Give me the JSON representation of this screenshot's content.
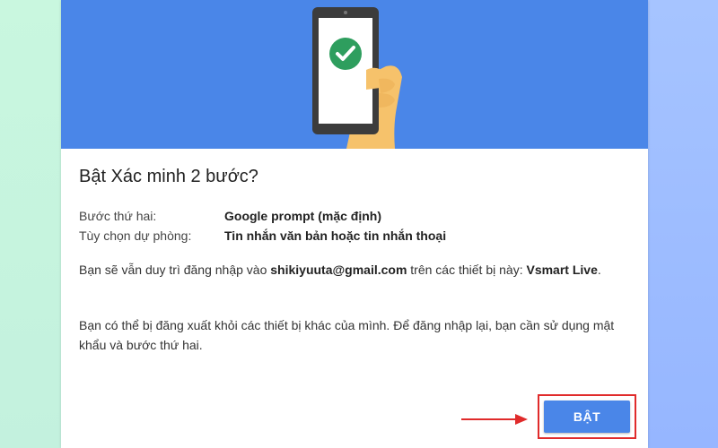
{
  "dialog": {
    "title": "Bật Xác minh 2 bước?",
    "details": [
      {
        "label": "Bước thứ hai:",
        "value": "Google prompt (mặc định)"
      },
      {
        "label": "Tùy chọn dự phòng:",
        "value": "Tin nhắn văn bản hoặc tin nhắn thoại"
      }
    ],
    "para1": {
      "text_a": "Bạn sẽ vẫn duy trì đăng nhập vào ",
      "email": "shikiyuuta@gmail.com",
      "text_b": " trên các thiết bị này: ",
      "device": "Vsmart Live",
      "text_c": "."
    },
    "para2": "Bạn có thể bị đăng xuất khỏi các thiết bị khác của mình. Để đăng nhập lại, bạn cần sử dụng mật khẩu và bước thứ hai.",
    "button_label": "BẬT"
  },
  "colors": {
    "banner": "#4a86e8",
    "check": "#2e9e5e",
    "button": "#4a86e8",
    "highlight": "#e02b2b"
  },
  "icons": {
    "banner": "phone-hand-check-illustration",
    "arrow": "red-arrow-right-icon"
  }
}
